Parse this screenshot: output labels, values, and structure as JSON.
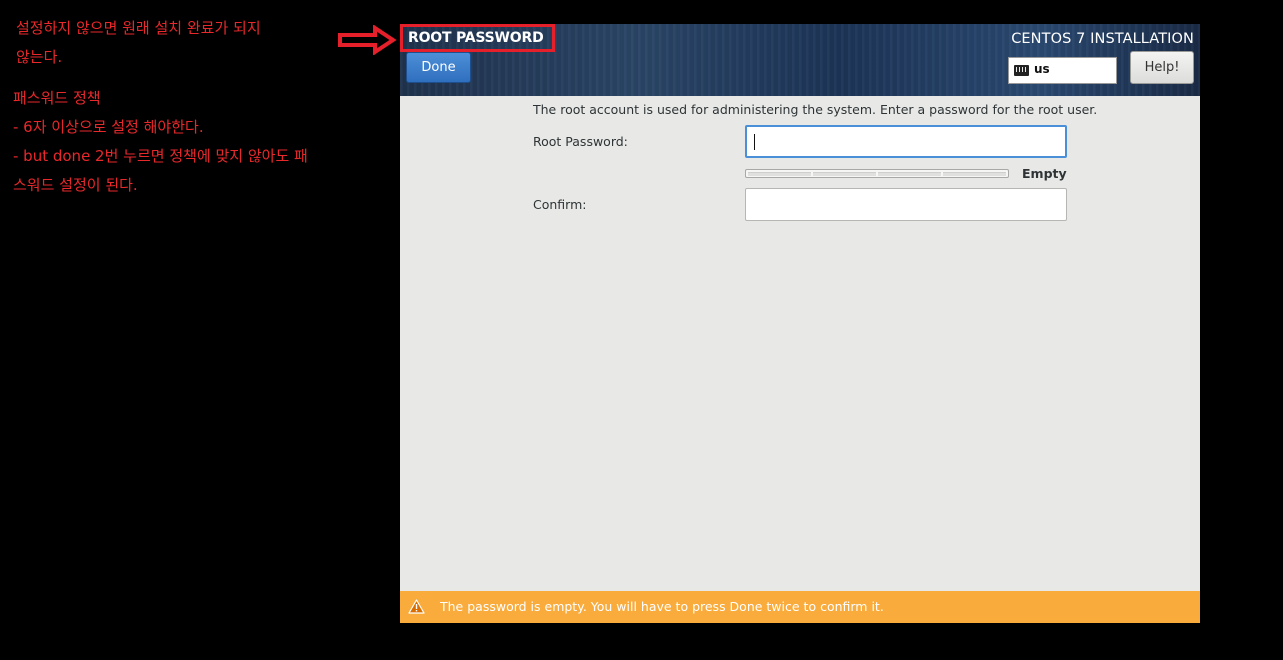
{
  "annotations": {
    "top_note_lines": [
      "설정하지 않으면 원래 설치 완료가 되지",
      "않는다."
    ],
    "policy_note_lines": [
      "패스워드 정책",
      "- 6자 이상으로 설정 해야한다.",
      "- but done 2번 누르면 정책에 맞지 않아도 패",
      "스워드 설정이 된다."
    ],
    "color": "#e8282b"
  },
  "header": {
    "screen_title": "ROOT PASSWORD",
    "product_title": "CENTOS 7 INSTALLATION",
    "done_label": "Done",
    "help_label": "Help!",
    "keyboard_layout": "us",
    "keyboard_icon": "keyboard-icon"
  },
  "form": {
    "intro": "The root account is used for administering the system.  Enter a password for the root user.",
    "root_password_label": "Root Password:",
    "root_password_value": "",
    "confirm_label": "Confirm:",
    "confirm_value": "",
    "strength_label": "Empty",
    "strength_level": 0
  },
  "warning": {
    "icon": "warning-icon",
    "text": "The password is empty. You will have to press Done twice to confirm it.",
    "color": "#f9ab3c"
  },
  "colors": {
    "accent_blue": "#3f80cf",
    "annotation_red": "#e5202a"
  }
}
